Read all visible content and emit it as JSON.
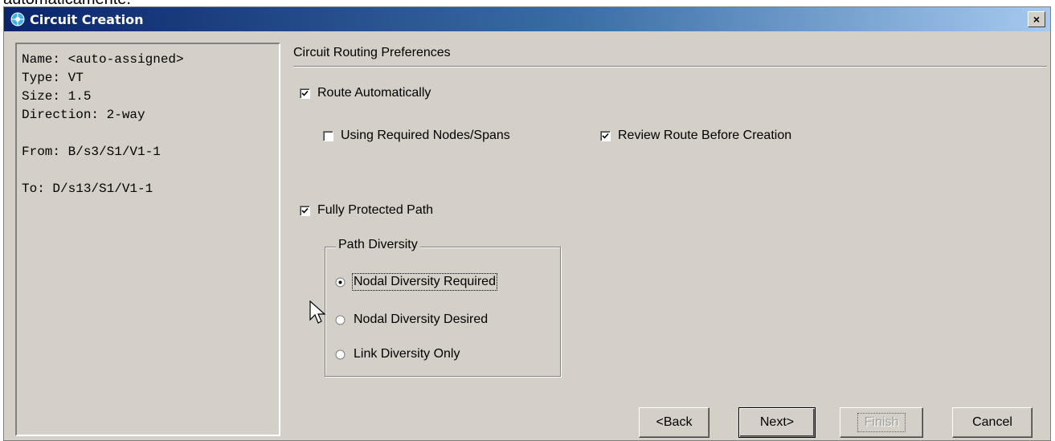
{
  "background_text": "automaticamente.",
  "window": {
    "title": "Circuit Creation",
    "close_label": "×"
  },
  "summary": {
    "name": "Name: <auto-assigned>",
    "type": "Type: VT",
    "size": "Size: 1.5",
    "direction": "Direction: 2-way",
    "from": "From: B/s3/S1/V1-1",
    "to": "To: D/s13/S1/V1-1"
  },
  "routing": {
    "section_title": "Circuit Routing Preferences",
    "route_automatically": {
      "label": "Route Automatically",
      "checked": true
    },
    "using_required_nodes": {
      "label": "Using Required Nodes/Spans",
      "checked": false
    },
    "review_route": {
      "label": "Review Route Before Creation",
      "checked": true
    },
    "fully_protected_path": {
      "label": "Fully Protected Path",
      "checked": true
    }
  },
  "path_diversity": {
    "title": "Path Diversity",
    "options": [
      {
        "label": "Nodal Diversity Required",
        "selected": true
      },
      {
        "label": "Nodal Diversity Desired",
        "selected": false
      },
      {
        "label": "Link Diversity Only",
        "selected": false
      }
    ]
  },
  "buttons": {
    "back": "<Back",
    "next": "Next>",
    "finish": "Finish",
    "cancel": "Cancel"
  },
  "colors": {
    "window_bg": "#d4d0c8",
    "titlebar_start": "#0a246a",
    "titlebar_end": "#a6caf0"
  }
}
